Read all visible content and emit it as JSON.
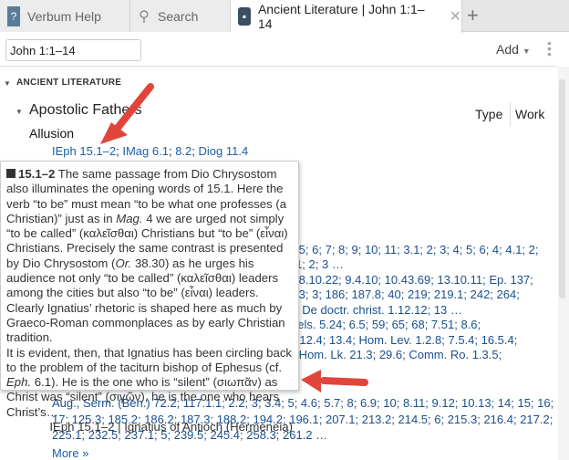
{
  "tabs": [
    {
      "label": "Verbum Help",
      "icon": "help-icon"
    },
    {
      "label": "Search",
      "icon": "search-icon"
    },
    {
      "label": "Ancient Literature | John 1:1–14",
      "icon": "book-icon",
      "active": true
    }
  ],
  "reference": "John 1:1–14",
  "add_label": "Add",
  "section_title": "ANCIENT LITERATURE",
  "group": "Apostolic Fathers",
  "columns": [
    "Type",
    "Work"
  ],
  "subheading": "Allusion",
  "allusion_links": [
    "IEph 15.1–2",
    "IMag 6.1",
    "8.2",
    "Diog 11.4"
  ],
  "background_lines": [
    "; 4; 5; 6; 7; 8; 9; 10; 11; 3.1; 2; 3; 4; 5; 6; 4; 4.1; 2;",
    "10.1; 2; 3 …",
    "25; 8.10.22; 9.4.10; 10.43.69; 13.10.11; Ep. 137;",
    "5.1.3; 3; 186; 187.8; 40; 219; 219.1; 242; 264;",
    "2.1; De doctr. christ. 1.12.12; 13 …",
    "t. Cels. 5.24; 6.5; 59; 65; 68; 7.51; 8.6;",
    "Ex. 12.4; 13.4; Hom. Lev. 1.2.8; 7.5.4; 16.5.4;",
    "; 2; Hom. Lk. 21.3; 29.6; Comm. Ro. 1.3.5;"
  ],
  "augustine_lines": [
    "Aug., Serm. (Ben.) 72.2; 117.1.1; 2.2; 3; 3.4; 5; 4.6; 5.7; 8; 6.9; 10; 8.11; 9.12; 10.13; 14; 15; 16;",
    "17; 125.3; 185.2; 186.2; 187.3; 188.2; 194.2; 196.1; 207.1; 213.2; 214.5; 6; 215.3; 216.4; 217.2;",
    "225.1; 232.5; 237.1; 5; 239.5; 245.4; 258.3; 261.2 …"
  ],
  "more_label": "More »",
  "popup": {
    "ref": "15.1–2",
    "p1a": " The same passage from Dio Chrysostom also illuminates the opening words of 15.1. Here the verb “to be” must mean “to be what one professes (a Christian)” just as in ",
    "p1_mag": "Mag.",
    "p1b": " 4 we are urged not simply “to be called” (καλεῖσθαι) Christians but “to be” (εἶναι) Christians. Precisely the same contrast is presented by Dio Chrysostom (",
    "p1_or": "Or.",
    "p1c": " 38.30) as he urges his audience not only “to be called” (καλεῖσθαι) leaders among the cities but also “to be” (εἶναι) leaders. Clearly Ignatius’ rhetoric is shaped here as much by Graeco-Roman commonplaces as by early Christian tradition.",
    "p2a": "It is evident, then, that Ignatius has been circling back to the problem of the taciturn bishop of Ephesus (cf. ",
    "p2_eph": "Eph.",
    "p2b": " 6.1). He is the one who is “silent” (σιωπᾶν) as Christ was “silent” (σιγῶν), he is the one who hears Christ’s…",
    "source": "IEph 15.1–2 | Ignatius of Antioch (Hermeneia)"
  },
  "colors": {
    "link": "#1b5fa8",
    "arrow": "#e0453b",
    "tab_bg": "#e6e6e6"
  }
}
